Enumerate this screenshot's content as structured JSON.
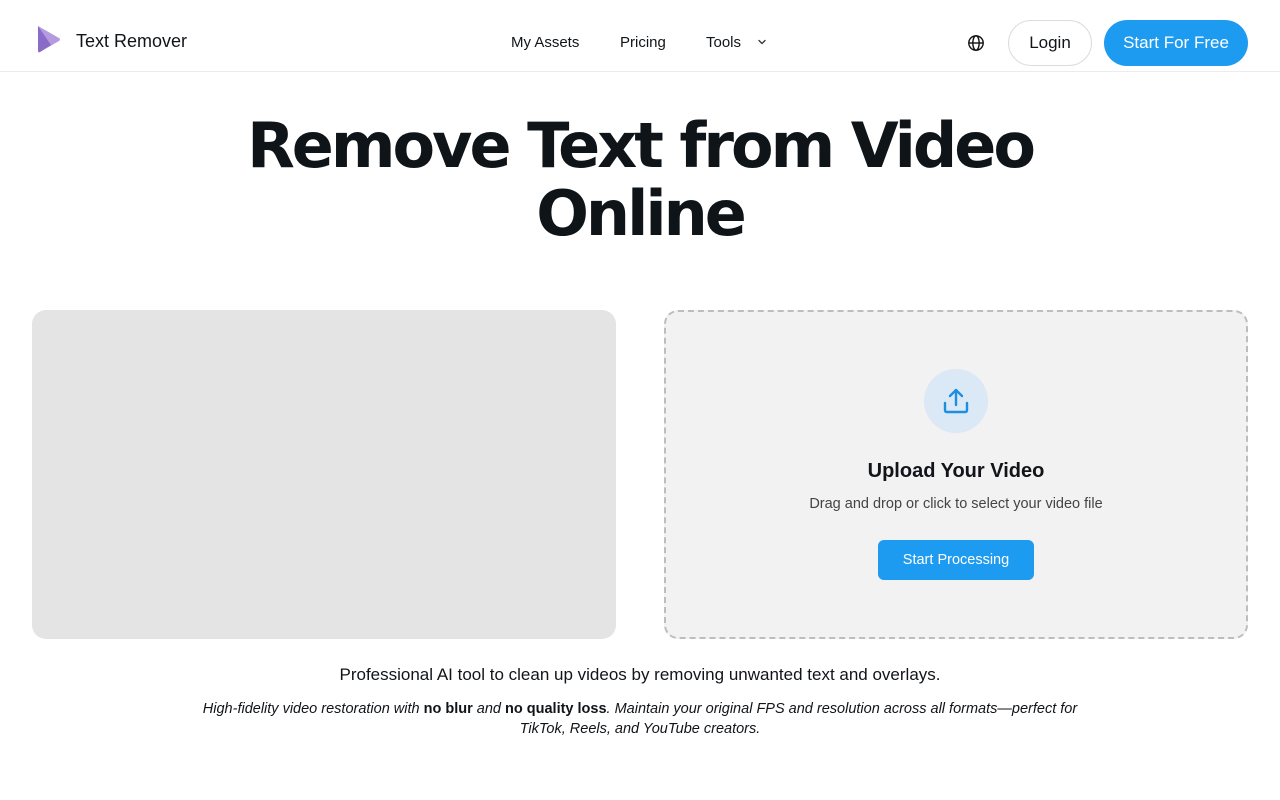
{
  "header": {
    "brand_name": "Text Remover",
    "nav": {
      "my_assets": "My Assets",
      "pricing": "Pricing",
      "tools": "Tools"
    },
    "login_label": "Login",
    "start_label": "Start For Free",
    "icons": {
      "logo": "play-logo-icon",
      "tools_dropdown": "chevron-down-icon",
      "language": "globe-icon"
    }
  },
  "hero": {
    "title": "Remove Text from Video Online"
  },
  "upload": {
    "title": "Upload Your Video",
    "subtitle": "Drag and drop or click to select your video file",
    "button_label": "Start Processing",
    "icon": "upload-icon"
  },
  "description": {
    "line1": "Professional AI tool to clean up videos by removing unwanted text and overlays.",
    "line2_part1": "High-fidelity video restoration with ",
    "line2_bold1": "no blur",
    "line2_part2": " and ",
    "line2_bold2": "no quality loss",
    "line2_part3": ". Maintain your original FPS and resolution across all formats—perfect for TikTok, Reels, and YouTube creators."
  },
  "colors": {
    "accent": "#1d9bf0",
    "logo_purple": "#9b7fd1",
    "upload_bg": "#f2f2f2",
    "preview_bg": "#e4e4e4"
  }
}
